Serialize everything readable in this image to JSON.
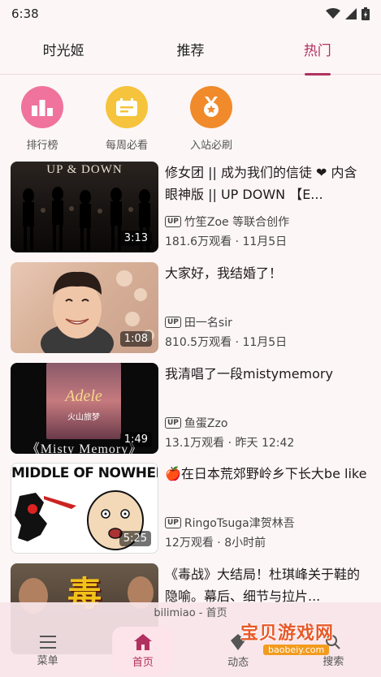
{
  "status_bar": {
    "time": "6:38"
  },
  "tabs": [
    {
      "label": "时光姬",
      "active": false
    },
    {
      "label": "推荐",
      "active": false
    },
    {
      "label": "热门",
      "active": true
    }
  ],
  "quick_links": [
    {
      "label": "排行榜",
      "color": "#f0739d",
      "icon": "ranking-icon"
    },
    {
      "label": "每周必看",
      "color": "#f5c43c",
      "icon": "weekly-icon"
    },
    {
      "label": "入站必刷",
      "color": "#f08a2a",
      "icon": "medal-icon"
    }
  ],
  "videos": [
    {
      "title": "修女团 || 成为我们的信徒 ❤ 内含眼神版 || UP DOWN 【E...",
      "uploader": "竹笙Zoe 等联合创作",
      "views": "181.6万观看",
      "date": "11月5日",
      "duration": "3:13",
      "thumb_text": "UP & DOWN"
    },
    {
      "title": "大家好，我结婚了！",
      "uploader": "田一名sir",
      "views": "810.5万观看",
      "date": "11月5日",
      "duration": "1:08",
      "thumb_text": ""
    },
    {
      "title": "我清唱了一段mistymemory",
      "uploader": "鱼蛋Zzo",
      "views": "13.1万观看",
      "date": "昨天 12:42",
      "duration": "1:49",
      "thumb_text": "《Misty Memory》"
    },
    {
      "title": "🍎在日本荒郊野岭乡下长大be like",
      "uploader": "RingoTsuga津贺林吾",
      "views": "12万观看",
      "date": "8小时前",
      "duration": "5:25",
      "thumb_text": "MIDDLE OF NOWHERE"
    },
    {
      "title": "《毒战》大结局！杜琪峰关于鞋的隐喻。幕后、细节与拉片...",
      "uploader": "",
      "views": "",
      "date": "",
      "duration": "",
      "thumb_text": "毒"
    }
  ],
  "app_label": "bilimiao - 首页",
  "bottom_nav": [
    {
      "label": "菜单",
      "icon": "menu-icon",
      "active": false
    },
    {
      "label": "首页",
      "icon": "home-icon",
      "active": true
    },
    {
      "label": "动态",
      "icon": "dynamic-icon",
      "active": false
    },
    {
      "label": "搜索",
      "icon": "search-icon",
      "active": false
    }
  ],
  "watermark": {
    "text": "宝贝游戏网",
    "url": "baobeiy.com"
  },
  "accent_color": "#b0315f"
}
